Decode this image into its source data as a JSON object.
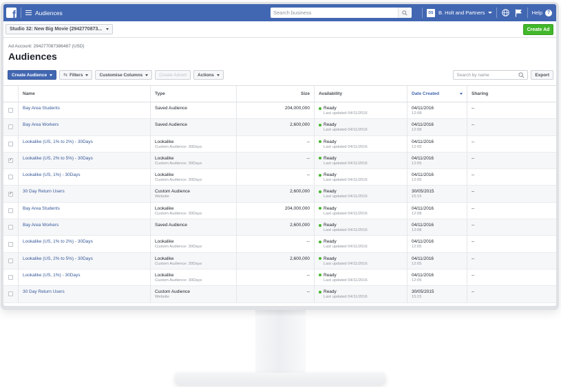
{
  "topbar": {
    "title": "Audiences",
    "search_placeholder": "Search business",
    "business_initials": "DS",
    "business_name": "B. Holt and Partners",
    "help_label": "Help",
    "help_icon_char": "?"
  },
  "subbar": {
    "account_selector": "Studio 32: New Big Movie (2942770873...",
    "create_ad_label": "Create Ad"
  },
  "header": {
    "ad_account": "Ad Account: 294277087386487 (USD)",
    "title": "Audiences"
  },
  "toolbar": {
    "create_audience": "Create Audience",
    "filters": "Filters",
    "customise_columns": "Customise Columns",
    "create_advert": "Create Advert",
    "actions": "Actions",
    "search_placeholder": "Search by name",
    "export": "Export"
  },
  "table": {
    "columns": [
      "Name",
      "Type",
      "Size",
      "Availability",
      "Date Created",
      "Sharing"
    ],
    "rows": [
      {
        "checked": false,
        "name": "Bay Area Students",
        "type": "Saved Audience",
        "type_sub": "",
        "size": "204,000,000",
        "status": "Ready",
        "status_sub": "Last updated 04/11/2016",
        "date": "04/11/2016",
        "time": "12:08",
        "sharing": "--"
      },
      {
        "checked": false,
        "name": "Bay Area Workers",
        "type": "Saved Audience",
        "type_sub": "",
        "size": "2,600,000",
        "status": "Ready",
        "status_sub": "Last updated 04/11/2016",
        "date": "04/11/2016",
        "time": "12:08",
        "sharing": "--"
      },
      {
        "checked": false,
        "name": "Lookalike (US, 1% to 2%) - 30Days",
        "type": "Lookalike",
        "type_sub": "Custom Audience: 30Days",
        "size": "--",
        "status": "Ready",
        "status_sub": "Last updated 04/11/2016",
        "date": "04/11/2016",
        "time": "12:05",
        "sharing": "--"
      },
      {
        "checked": true,
        "name": "Lookalike (US, 2% to 5%) - 30Days",
        "type": "Lookalike",
        "type_sub": "Custom Audience: 30Days",
        "size": "--",
        "status": "Ready",
        "status_sub": "Last updated 04/11/2016",
        "date": "04/11/2016",
        "time": "12:05",
        "sharing": "--"
      },
      {
        "checked": false,
        "name": "Lookalike (US, 1%) - 30Days",
        "type": "Lookalike",
        "type_sub": "Custom Audience: 30Days",
        "size": "--",
        "status": "Ready",
        "status_sub": "Last updated 04/11/2016",
        "date": "04/11/2016",
        "time": "12:05",
        "sharing": "--"
      },
      {
        "checked": true,
        "name": "30 Day Return Users",
        "type": "Custom Audience",
        "type_sub": "Website",
        "size": "2,600,000",
        "status": "Ready",
        "status_sub": "Last updated 04/11/2016",
        "date": "30/05/2015",
        "time": "15:15",
        "sharing": "--"
      },
      {
        "checked": false,
        "name": "Bay Area Students",
        "type": "Lookalike",
        "type_sub": "Custom Audience: 30Days",
        "size": "204,000,000",
        "status": "Ready",
        "status_sub": "Last updated 04/11/2016",
        "date": "04/11/2016",
        "time": "12:08",
        "sharing": "--"
      },
      {
        "checked": false,
        "name": "Bay Area Workers",
        "type": "Saved Audience",
        "type_sub": "",
        "size": "2,600,000",
        "status": "Ready",
        "status_sub": "Last updated 04/11/2016",
        "date": "04/11/2016",
        "time": "12:08",
        "sharing": "--"
      },
      {
        "checked": false,
        "name": "Lookalike (US, 1% to 2%) - 30Days",
        "type": "Lookalike",
        "type_sub": "Custom Audience: 30Days",
        "size": "--",
        "status": "Ready",
        "status_sub": "Last updated 04/11/2016",
        "date": "04/11/2016",
        "time": "12:05",
        "sharing": "--"
      },
      {
        "checked": false,
        "name": "Lookalike (US, 2% to 5%) - 30Days",
        "type": "Lookalike",
        "type_sub": "Custom Audience: 30Days",
        "size": "2,600,000",
        "status": "Ready",
        "status_sub": "Last updated 04/11/2016",
        "date": "04/11/2016",
        "time": "12:05",
        "sharing": "--"
      },
      {
        "checked": false,
        "name": "Lookalike (US, 1%) - 30Days",
        "type": "Lookalike",
        "type_sub": "Custom Audience: 30Days",
        "size": "--",
        "status": "Ready",
        "status_sub": "Last updated 04/11/2016",
        "date": "04/11/2016",
        "time": "12:05",
        "sharing": "--"
      },
      {
        "checked": false,
        "name": "30 Day Return Users",
        "type": "Custom Audience",
        "type_sub": "Website",
        "size": "--",
        "status": "Ready",
        "status_sub": "Last updated 04/11/2016",
        "date": "30/05/2015",
        "time": "15:15",
        "sharing": "--"
      }
    ]
  },
  "colors": {
    "topbar": "#4267b2",
    "create_ad": "#42b72a",
    "link": "#365899",
    "ready_dot": "#42b72a"
  }
}
